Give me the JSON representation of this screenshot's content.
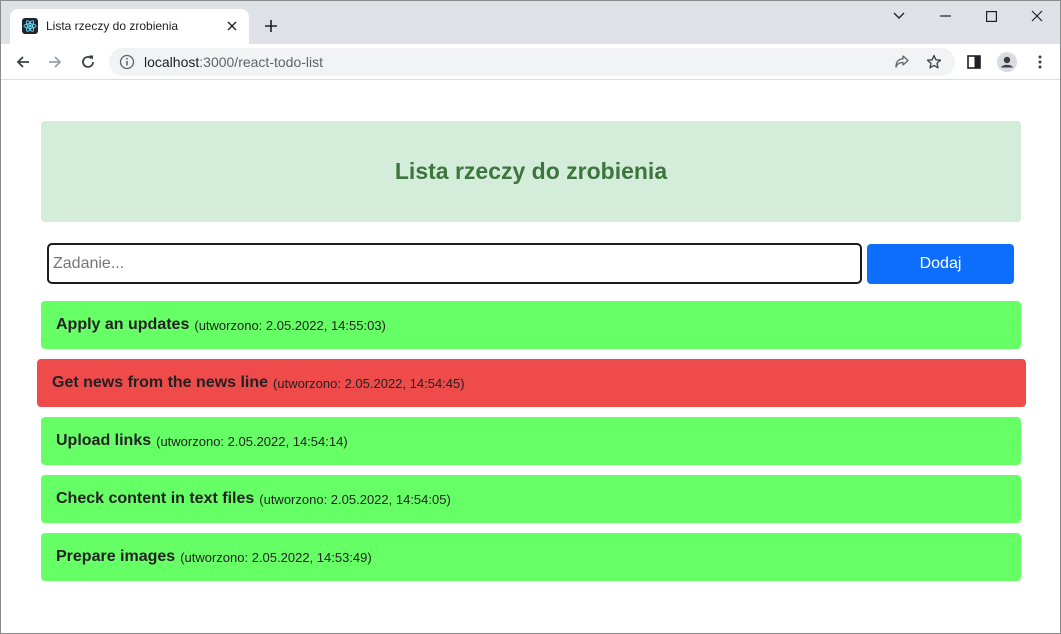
{
  "browser": {
    "tab_title": "Lista rzeczy do zrobienia",
    "url_host": "localhost",
    "url_path": ":3000/react-todo-list"
  },
  "page": {
    "title": "Lista rzeczy do zrobienia",
    "input_placeholder": "Zadanie...",
    "input_value": "",
    "add_button_label": "Dodaj"
  },
  "todos": [
    {
      "name": "Apply an updates",
      "meta": "(utworzono: 2.05.2022, 14:55:03)",
      "status": "done"
    },
    {
      "name": "Get news from the news line",
      "meta": "(utworzono: 2.05.2022, 14:54:45)",
      "status": "overdue"
    },
    {
      "name": "Upload links",
      "meta": "(utworzono: 2.05.2022, 14:54:14)",
      "status": "done"
    },
    {
      "name": "Check content in text files",
      "meta": "(utworzono: 2.05.2022, 14:54:05)",
      "status": "done"
    },
    {
      "name": "Prepare images",
      "meta": "(utworzono: 2.05.2022, 14:53:49)",
      "status": "done"
    }
  ],
  "colors": {
    "header_bg": "#d4edda",
    "header_text": "#3c763d",
    "button_bg": "#0d6efd",
    "todo_done": "#66ff66",
    "todo_overdue": "#ef4b4b"
  }
}
